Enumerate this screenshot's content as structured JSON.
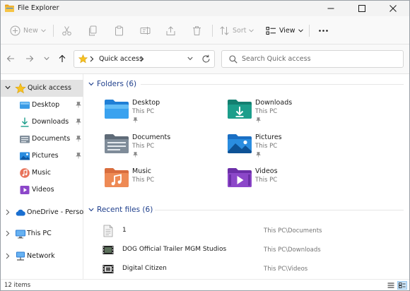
{
  "window": {
    "title": "File Explorer",
    "icon": "folder-icon"
  },
  "toolbar": {
    "new_label": "New",
    "sort_label": "Sort",
    "view_label": "View",
    "more_icon": "more-icon"
  },
  "address": {
    "crumb": "Quick access",
    "refresh_icon": "refresh-icon"
  },
  "search": {
    "placeholder": "Search Quick access"
  },
  "sidebar": {
    "items": [
      {
        "label": "Quick access",
        "icon": "star-icon",
        "expanded": true,
        "selected": true
      },
      {
        "label": "Desktop",
        "icon": "desktop-folder-icon",
        "pinned": true
      },
      {
        "label": "Downloads",
        "icon": "download-arrow-icon",
        "pinned": true
      },
      {
        "label": "Documents",
        "icon": "documents-folder-icon",
        "pinned": true
      },
      {
        "label": "Pictures",
        "icon": "pictures-folder-icon",
        "pinned": true
      },
      {
        "label": "Music",
        "icon": "music-icon"
      },
      {
        "label": "Videos",
        "icon": "videos-icon"
      },
      {
        "label": "OneDrive - Personal",
        "icon": "cloud-icon",
        "expandable": true
      },
      {
        "label": "This PC",
        "icon": "monitor-icon",
        "expandable": true
      },
      {
        "label": "Network",
        "icon": "network-icon",
        "expandable": true
      }
    ]
  },
  "folders_section": {
    "title": "Folders (6)",
    "items": [
      {
        "name": "Desktop",
        "location": "This PC",
        "pinned": true,
        "icon": "desktop-folder-icon"
      },
      {
        "name": "Downloads",
        "location": "This PC",
        "pinned": true,
        "icon": "downloads-folder-icon"
      },
      {
        "name": "Documents",
        "location": "This PC",
        "pinned": true,
        "icon": "documents-folder-icon"
      },
      {
        "name": "Pictures",
        "location": "This PC",
        "pinned": true,
        "icon": "pictures-folder-icon"
      },
      {
        "name": "Music",
        "location": "This PC",
        "pinned": false,
        "icon": "music-folder-icon"
      },
      {
        "name": "Videos",
        "location": "This PC",
        "pinned": false,
        "icon": "videos-folder-icon"
      }
    ]
  },
  "recent_section": {
    "title": "Recent files (6)",
    "items": [
      {
        "name": "1",
        "path": "This PC\\Documents",
        "icon": "document-file-icon"
      },
      {
        "name": "DOG  Official Trailer  MGM Studios",
        "path": "This PC\\Downloads",
        "icon": "video-file-icon"
      },
      {
        "name": "Digital Citizen",
        "path": "This PC\\Videos",
        "icon": "video-file-icon"
      }
    ]
  },
  "status": {
    "item_count": "12 items"
  },
  "colors": {
    "accent": "#1f3f8c",
    "selection": "#e3e3e3",
    "folder_yellow": "#f6c445",
    "downloads_teal": "#1c9e8b",
    "pictures_blue": "#2a8de0",
    "music_orange": "#ee8a55",
    "videos_purple": "#8c47c9"
  }
}
